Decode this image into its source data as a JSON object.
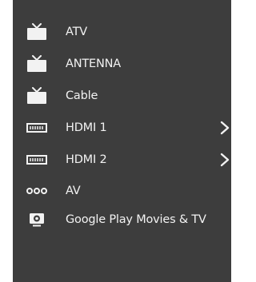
{
  "input_menu": {
    "background_color": "#3d3d3d",
    "text_color": "#f2f2f2",
    "items": [
      {
        "label": "ATV",
        "icon": "tv-icon",
        "has_submenu": false
      },
      {
        "label": "ANTENNA",
        "icon": "tv-icon",
        "has_submenu": false
      },
      {
        "label": "Cable",
        "icon": "tv-icon",
        "has_submenu": false
      },
      {
        "label": "HDMI 1",
        "icon": "hdmi-port-icon",
        "has_submenu": true
      },
      {
        "label": "HDMI 2",
        "icon": "hdmi-port-icon",
        "has_submenu": true
      },
      {
        "label": "AV",
        "icon": "av-connector-icon",
        "has_submenu": false
      },
      {
        "label": "Google Play Movies & TV",
        "icon": "play-movies-app-icon",
        "has_submenu": false
      }
    ]
  }
}
